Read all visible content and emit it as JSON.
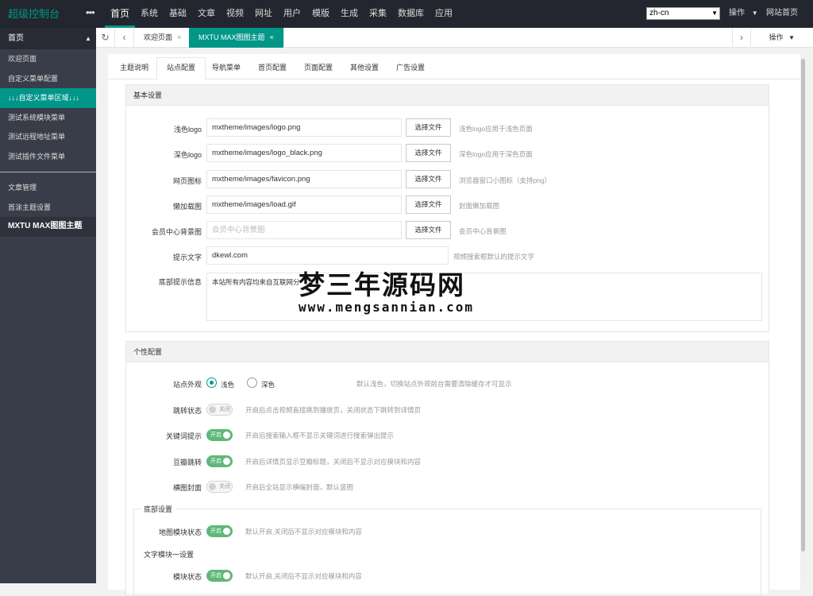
{
  "topbar": {
    "logo": "超级控制台",
    "menu_dots": "•••",
    "nav": [
      "首页",
      "系统",
      "基础",
      "文章",
      "视频",
      "网址",
      "用户",
      "模版",
      "生成",
      "采集",
      "数据库",
      "应用"
    ],
    "language": "zh-cn",
    "operate": "操作",
    "site_home": "网站首页"
  },
  "sidebar": {
    "head": "首页",
    "group1": [
      "欢迎页面",
      "自定义菜单配置",
      "↓↓↓自定义菜单区域↓↓↓",
      "测试系统模块菜单",
      "测试远程地址菜单",
      "测试插件文件菜单"
    ],
    "group2": [
      "文章管理",
      "首涂主题设置",
      "MXTU MAX图图主题"
    ]
  },
  "pagetabs": {
    "welcome": "欢迎页面",
    "theme": "MXTU MAX图图主题",
    "close": "×",
    "operate": "操作"
  },
  "subtabs": [
    "主题说明",
    "站点配置",
    "导航菜单",
    "首页配置",
    "页面配置",
    "其他设置",
    "广告设置"
  ],
  "basic": {
    "title": "基本设置",
    "pick_label": "选择文件",
    "rows": [
      {
        "label": "浅色logo",
        "value": "mxtheme/images/logo.png",
        "tip": "浅色logo应用于浅色页面"
      },
      {
        "label": "深色logo",
        "value": "mxtheme/images/logo_black.png",
        "tip": "深色logo应用于深色页面"
      },
      {
        "label": "网页图标",
        "value": "mxtheme/images/favicon.png",
        "tip": "浏览器窗口小图标（支持png）"
      },
      {
        "label": "懒加载图",
        "value": "mxtheme/images/load.gif",
        "tip": "封面懒加载图"
      },
      {
        "label": "会员中心背景图",
        "placeholder": "会员中心背景图",
        "tip": "会员中心背景图"
      }
    ],
    "prompt_label": "提示文字",
    "prompt_value": "dkewl.com",
    "prompt_tip": "视频搜索框默认的提示文字",
    "footer_label": "底部提示信息",
    "footer_value": "本站所有内容均来自互联网分"
  },
  "personal": {
    "title": "个性配置",
    "appearance_label": "站点外观",
    "light": "浅色",
    "dark": "深色",
    "appearance_tip": "默认浅色，切换站点外观前台需要清除缓存才可显示",
    "switches": [
      {
        "label": "跳转状态",
        "state": "关闭",
        "on": false,
        "tip": "开启后点击视频直接跳到播放页，关闭状态下跳转到详情页"
      },
      {
        "label": "关键词提示",
        "state": "开启",
        "on": true,
        "tip": "开启后搜索输入框不显示关键词进行搜索弹出提示"
      },
      {
        "label": "豆瓣跳转",
        "state": "开启",
        "on": true,
        "tip": "开启后详情页显示豆瓣标题，关闭后不显示对应模块和内容"
      },
      {
        "label": "横图封面",
        "state": "关闭",
        "on": false,
        "tip": "开启后全站显示横幅封面，默认竖图"
      }
    ],
    "footer_legend": "底部设置",
    "map_label": "地图模块状态",
    "map_state": "开启",
    "map_tip": "默认开启,关闭后不显示对应模块和内容",
    "text_legend": "文字模块一设置",
    "module_label": "模块状态",
    "module_state": "开启",
    "module_tip": "默认开启,关闭后不显示对应模块和内容"
  },
  "watermark": {
    "title": "梦三年源码网",
    "url": "www.mengsannian.com"
  },
  "colors": {
    "accent": "#009688",
    "topbar": "#23262e",
    "sidebar": "#393d49",
    "switch_on": "#5fb878"
  }
}
